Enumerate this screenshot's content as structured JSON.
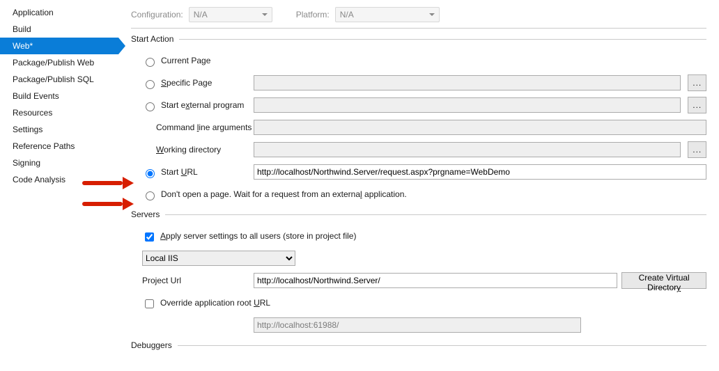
{
  "sidebar": {
    "items": [
      {
        "label": "Application"
      },
      {
        "label": "Build"
      },
      {
        "label": "Web*",
        "active": true
      },
      {
        "label": "Package/Publish Web"
      },
      {
        "label": "Package/Publish SQL"
      },
      {
        "label": "Build Events"
      },
      {
        "label": "Resources"
      },
      {
        "label": "Settings"
      },
      {
        "label": "Reference Paths"
      },
      {
        "label": "Signing"
      },
      {
        "label": "Code Analysis"
      }
    ]
  },
  "config": {
    "configuration_label": "Configuration:",
    "configuration_value": "N/A",
    "platform_label": "Platform:",
    "platform_value": "N/A"
  },
  "sections": {
    "start_action": "Start Action",
    "servers": "Servers",
    "debuggers": "Debuggers"
  },
  "start_action": {
    "current_page": "Current Page",
    "specific_page_pre": "",
    "specific_page_mn": "S",
    "specific_page_post": "pecific Page",
    "external_prog_pre": "Start e",
    "external_prog_mn": "x",
    "external_prog_post": "ternal program",
    "cmd_args_pre": "Command ",
    "cmd_args_mn": "l",
    "cmd_args_post": "ine arguments",
    "work_dir_pre": "",
    "work_dir_mn": "W",
    "work_dir_post": "orking directory",
    "start_url_pre": "Start ",
    "start_url_mn": "U",
    "start_url_post": "RL",
    "start_url_value": "http://localhost/Northwind.Server/request.aspx?prgname=WebDemo",
    "no_open_pre": "Don't open a page.  Wait for a request from an externa",
    "no_open_mn": "l",
    "no_open_post": " application.",
    "selected": "start_url",
    "specific_page_value": "",
    "external_prog_value": "",
    "cmd_args_value": "",
    "work_dir_value": "",
    "ellipsis": "..."
  },
  "servers": {
    "apply_pre": "",
    "apply_mn": "A",
    "apply_post": "pply server settings to all users (store in project file)",
    "apply_checked": true,
    "server_select": "Local IIS",
    "project_url_label": "Project Url",
    "project_url_value": "http://localhost/Northwind.Server/",
    "create_vd_pre": "Create Virtual Director",
    "create_vd_mn": "y",
    "override_pre": "Override application root ",
    "override_mn": "U",
    "override_post": "RL",
    "override_checked": false,
    "override_value": "http://localhost:61988/"
  }
}
